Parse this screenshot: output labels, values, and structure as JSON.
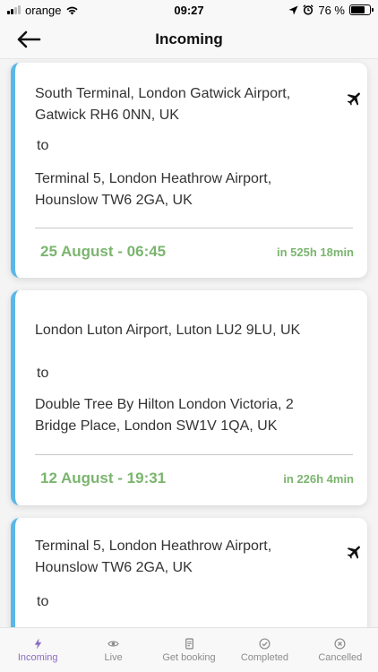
{
  "status_bar": {
    "carrier": "orange",
    "time": "09:27",
    "battery": "76 %",
    "battery_level": 0.76
  },
  "header": {
    "title": "Incoming"
  },
  "trips": [
    {
      "from": "South Terminal, London Gatwick Airport, Gatwick RH6 0NN, UK",
      "to_label": "to",
      "to": "Terminal 5, London Heathrow Airport, Hounslow TW6 2GA, UK",
      "date": "25 August - 06:45",
      "eta": "in 525h 18min",
      "icon": "airplane-icon"
    },
    {
      "from": "London Luton Airport, Luton LU2 9LU, UK",
      "to_label": "to",
      "to": "Double Tree By Hilton London Victoria, 2 Bridge Place, London SW1V 1QA, UK",
      "date": "12 August - 19:31",
      "eta": "in 226h 4min"
    },
    {
      "from": "Terminal 5, London Heathrow Airport, Hounslow TW6 2GA, UK",
      "to_label": "to",
      "icon": "airplane-icon"
    }
  ],
  "tabs": [
    {
      "label": "Incoming",
      "icon": "lightning-icon",
      "active": true
    },
    {
      "label": "Live",
      "icon": "eye-icon"
    },
    {
      "label": "Get booking",
      "icon": "receipt-icon"
    },
    {
      "label": "Completed",
      "icon": "check-circle-icon"
    },
    {
      "label": "Cancelled",
      "icon": "x-circle-icon"
    }
  ],
  "colors": {
    "accent_stripe": "#5bb7e8",
    "date_green": "#7bb56f",
    "active_tab": "#8a6cc2"
  }
}
